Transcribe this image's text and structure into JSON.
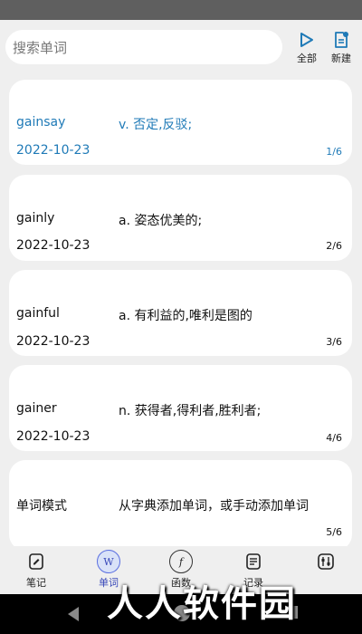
{
  "search": {
    "placeholder": "搜索单词"
  },
  "top_actions": {
    "all_label": "全部",
    "new_label": "新建"
  },
  "entries": [
    {
      "word": "gainsay",
      "meaning": "v. 否定,反驳;",
      "date": "2022-10-23",
      "index": "1/6",
      "active": true
    },
    {
      "word": "gainly",
      "meaning": "a. 姿态优美的;",
      "date": "2022-10-23",
      "index": "2/6"
    },
    {
      "word": "gainful",
      "meaning": "a. 有利益的,唯利是图的",
      "date": "2022-10-23",
      "index": "3/6"
    },
    {
      "word": "gainer",
      "meaning": "n. 获得者,得利者,胜利者;",
      "date": "2022-10-23",
      "index": "4/6"
    },
    {
      "word": "单词模式",
      "meaning": "从字典添加单词，或手动添加单词",
      "date": "",
      "index": "5/6"
    }
  ],
  "tabs": [
    {
      "label": "笔记",
      "icon": "note-icon"
    },
    {
      "label": "单词",
      "icon": "word-icon",
      "active": true
    },
    {
      "label": "函数",
      "icon": "function-icon"
    },
    {
      "label": "记录",
      "icon": "record-icon"
    },
    {
      "label": "",
      "icon": "settings-sliders-icon"
    }
  ],
  "watermark": "人人软件园",
  "colors": {
    "accent": "#1f7ab7",
    "tab_active": "#3747b8",
    "background": "#efefef"
  }
}
